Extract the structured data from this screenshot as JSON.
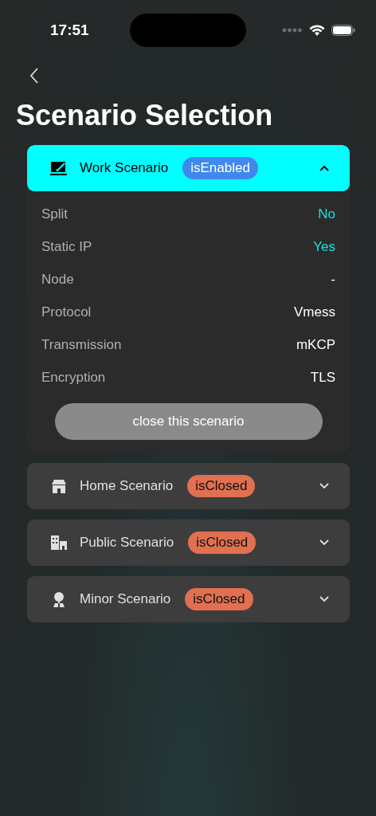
{
  "status_bar": {
    "time": "17:51"
  },
  "title": "Scenario Selection",
  "scenarios": [
    {
      "name": "Work Scenario",
      "status": "isEnabled",
      "enabled": true,
      "expanded": true,
      "details": [
        {
          "label": "Split",
          "value": "No",
          "highlighted": true
        },
        {
          "label": "Static IP",
          "value": "Yes",
          "highlighted": true
        },
        {
          "label": "Node",
          "value": "-",
          "highlighted": false
        },
        {
          "label": "Protocol",
          "value": "Vmess",
          "highlighted": false
        },
        {
          "label": "Transmission",
          "value": "mKCP",
          "highlighted": false
        },
        {
          "label": "Encryption",
          "value": "TLS",
          "highlighted": false
        }
      ],
      "action": "close this scenario"
    },
    {
      "name": "Home Scenario",
      "status": "isClosed",
      "enabled": false,
      "expanded": false
    },
    {
      "name": "Public Scenario",
      "status": "isClosed",
      "enabled": false,
      "expanded": false
    },
    {
      "name": "Minor Scenario",
      "status": "isClosed",
      "enabled": false,
      "expanded": false
    }
  ]
}
